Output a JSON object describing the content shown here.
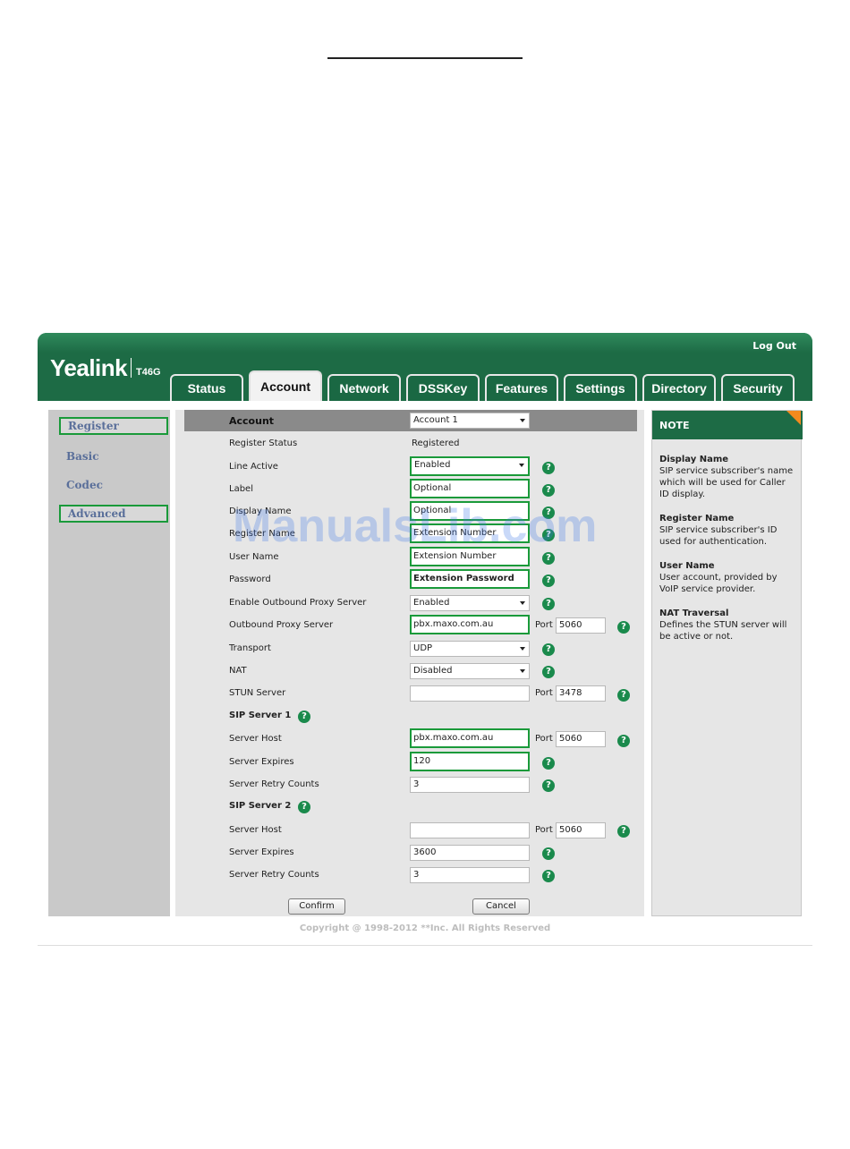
{
  "header": {
    "brand": "Yealink",
    "model": "T46G",
    "logout": "Log Out"
  },
  "tabs": [
    "Status",
    "Account",
    "Network",
    "DSSKey",
    "Features",
    "Settings",
    "Directory",
    "Security"
  ],
  "active_tab": "Account",
  "sidebar": {
    "items": [
      "Register",
      "Basic",
      "Codec",
      "Advanced"
    ],
    "highlighted": [
      "Register",
      "Advanced"
    ]
  },
  "form": {
    "account_label": "Account",
    "account_value": "Account 1",
    "register_status_label": "Register Status",
    "register_status_value": "Registered",
    "line_active_label": "Line Active",
    "line_active_value": "Enabled",
    "label_label": "Label",
    "label_value": "Optional",
    "display_name_label": "Display Name",
    "display_name_value": "Optional",
    "register_name_label": "Register Name",
    "register_name_value": "Extension Number",
    "user_name_label": "User Name",
    "user_name_value": "Extension Number",
    "password_label": "Password",
    "password_value": "Extension Password",
    "enable_outbound_label": "Enable Outbound Proxy Server",
    "enable_outbound_value": "Enabled",
    "outbound_proxy_label": "Outbound Proxy Server",
    "outbound_proxy_value": "pbx.maxo.com.au",
    "outbound_port": "5060",
    "transport_label": "Transport",
    "transport_value": "UDP",
    "nat_label": "NAT",
    "nat_value": "Disabled",
    "stun_label": "STUN Server",
    "stun_value": "",
    "stun_port": "3478",
    "port_label": "Port",
    "sip1_title": "SIP Server 1",
    "sip1_host_label": "Server Host",
    "sip1_host_value": "pbx.maxo.com.au",
    "sip1_port": "5060",
    "sip1_expires_label": "Server Expires",
    "sip1_expires_value": "120",
    "sip1_retry_label": "Server Retry Counts",
    "sip1_retry_value": "3",
    "sip2_title": "SIP Server 2",
    "sip2_host_label": "Server Host",
    "sip2_host_value": "",
    "sip2_port": "5060",
    "sip2_expires_label": "Server Expires",
    "sip2_expires_value": "3600",
    "sip2_retry_label": "Server Retry Counts",
    "sip2_retry_value": "3",
    "confirm": "Confirm",
    "cancel": "Cancel",
    "help_glyph": "?"
  },
  "note": {
    "title": "NOTE",
    "items": [
      {
        "title": "Display Name",
        "text": "SIP service subscriber's name which will be used for Caller ID display."
      },
      {
        "title": "Register Name",
        "text": "SIP service subscriber's ID used for authentication."
      },
      {
        "title": "User Name",
        "text": "User account, provided by VoIP service provider."
      },
      {
        "title": "NAT Traversal",
        "text": "Defines the STUN server will be active or not."
      }
    ]
  },
  "footer": {
    "copyright": "Copyright @ 1998-2012 **Inc. All Rights Reserved"
  },
  "watermark": "ManualsLib.com",
  "colors": {
    "brand_green": "#1d6b45",
    "highlight_green": "#1a9a3a",
    "note_corner": "#f28a1e",
    "help_icon": "#1a8a4c"
  }
}
